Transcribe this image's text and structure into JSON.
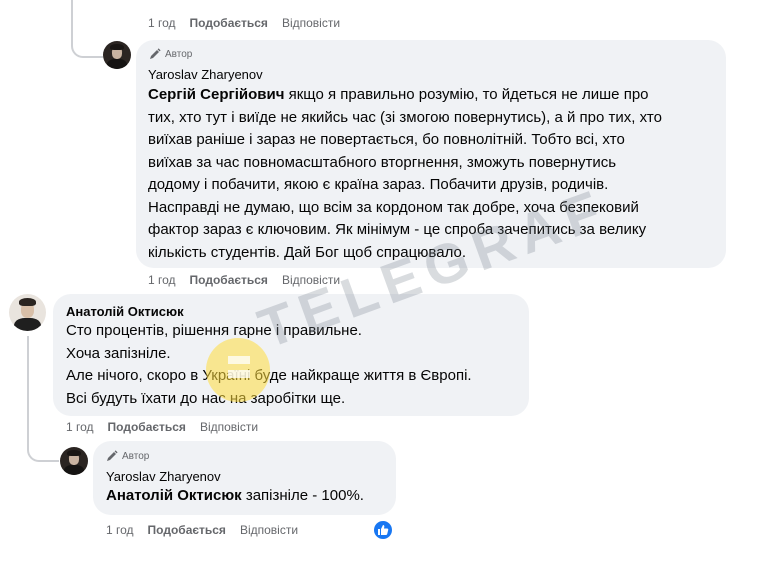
{
  "top_actions": {
    "time": "1 год",
    "like": "Подобається",
    "reply": "Відповісти"
  },
  "reply1": {
    "badge": "Автор",
    "name": "Yaroslav Zharyenov",
    "mention": "Сергій Сергійович",
    "lines": [
      " якщо я правильно розумію, то йдеться не лише про",
      "тих, хто тут і виїде не якийсь час (зі змогою повернутись), а й про тих, хто",
      "виїхав раніше і зараз не повертається, бо повнолітній. Тобто всі, хто",
      "виїхав за час повномасштабного вторгнення, зможуть повернутись",
      "додому і побачити, якою є країна зараз. Побачити друзів, родичів.",
      "Насправді не думаю, що всім за кордоном так добре, хоча безпековий",
      "фактор зараз є ключовим. Як мінімум - це спроба зачепитись за велику",
      "кількість студентів. Дай Бог щоб спрацювало."
    ],
    "actions": {
      "time": "1 год",
      "like": "Подобається",
      "reply": "Відповісти"
    }
  },
  "comment2": {
    "name": "Анатолій Октисюк",
    "lines": [
      "Сто процентів, рішення гарне і правильне.",
      "Хоча запізніле.",
      "Але нічого, скоро в Україні буде найкраще життя в Європі.",
      "Всі будуть їхати до нас на заробітки ще."
    ],
    "actions": {
      "time": "1 год",
      "like": "Подобається",
      "reply": "Відповісти"
    }
  },
  "reply3": {
    "badge": "Автор",
    "name": "Yaroslav Zharyenov",
    "mention": "Анатолій Октисюк",
    "text": " запізніле - 100%.",
    "actions": {
      "time": "1 год",
      "like": "Подобається",
      "reply": "Відповісти"
    }
  },
  "watermark": "TELEGRAF",
  "colors": {
    "bubble": "#f0f2f5",
    "secondary_text": "#65676b",
    "reaction_blue": "#1877f2"
  }
}
